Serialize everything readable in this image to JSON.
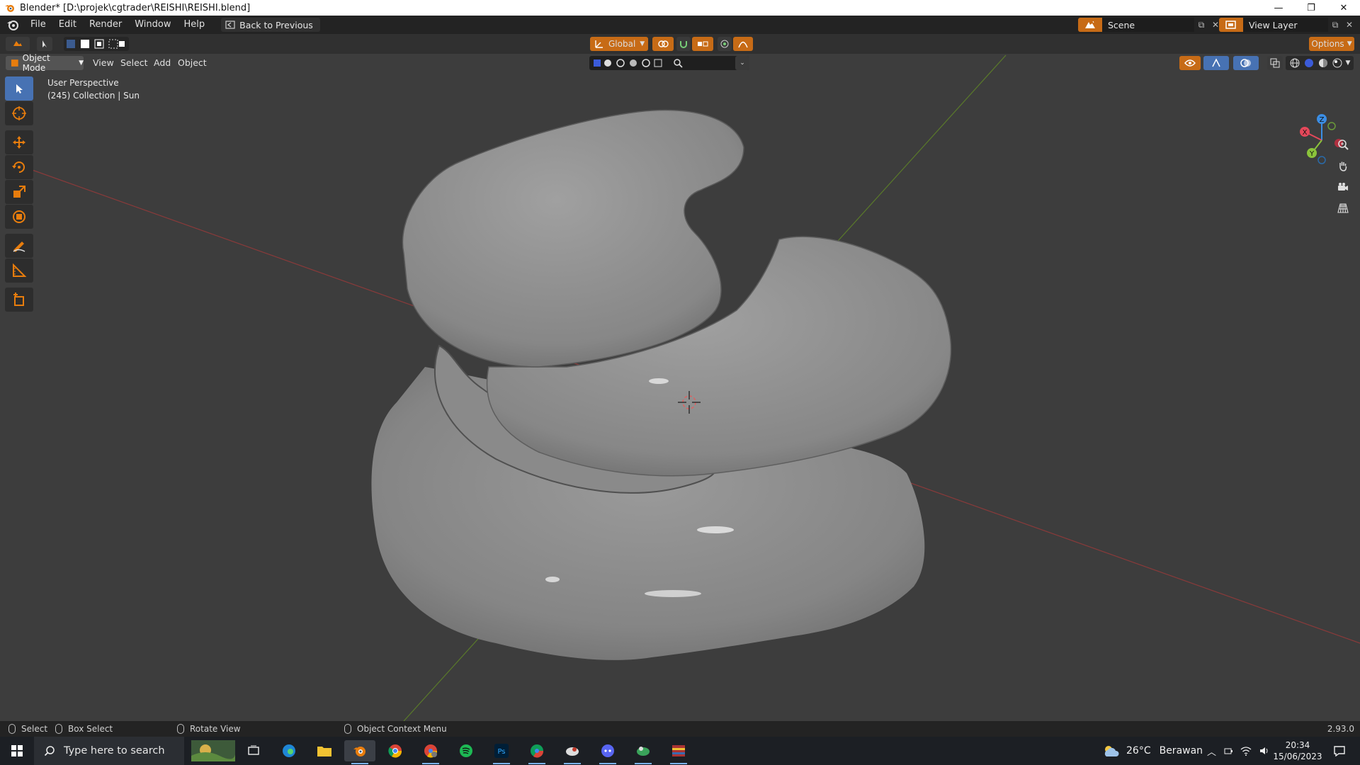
{
  "window": {
    "title": "Blender* [D:\\projek\\cgtrader\\REISHI\\REISHI.blend]",
    "minimize": "—",
    "maximize": "❐",
    "close": "✕"
  },
  "topbar": {
    "menu": [
      "File",
      "Edit",
      "Render",
      "Window",
      "Help"
    ],
    "back_label": "Back to Previous",
    "scene_name": "Scene",
    "view_layer_name": "View Layer"
  },
  "viewport_header": {
    "transform_orientation": "Global",
    "options_label": "Options",
    "mode_label": "Object Mode",
    "menus": [
      "View",
      "Select",
      "Add",
      "Object"
    ]
  },
  "viewport_overlay": {
    "view_name": "User Perspective",
    "context": "(245) Collection | Sun"
  },
  "nav_gizmo": {
    "x_label": "X",
    "y_label": "Y",
    "z_label": "Z",
    "x_color": "#e5485a",
    "y_color": "#8bc43b",
    "z_color": "#3b8ee5"
  },
  "statusbar": {
    "select": "Select",
    "box_select": "Box Select",
    "rotate_view": "Rotate View",
    "context_menu": "Object Context Menu",
    "version": "2.93.0"
  },
  "taskbar": {
    "search_placeholder": "Type here to search",
    "weather_temp": "26°C",
    "weather_desc": "Berawan",
    "time": "20:34",
    "date": "15/06/2023"
  },
  "colors": {
    "accent_orange": "#c76b16",
    "active_tool_blue": "#4772b3",
    "x_axis_line": "#8a3a3a",
    "y_axis_line": "#5a7a2a"
  }
}
